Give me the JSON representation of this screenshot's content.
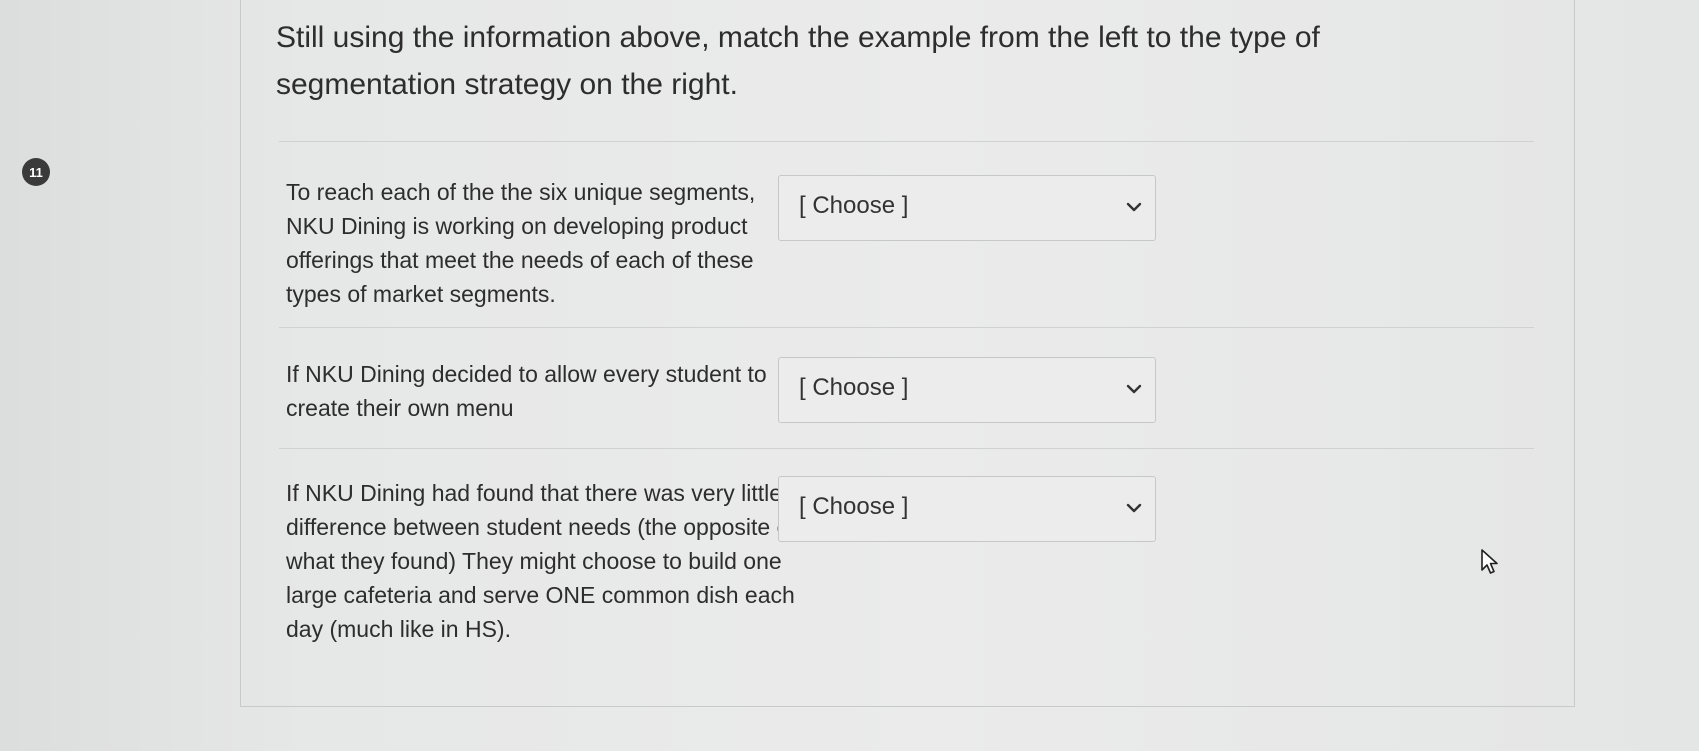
{
  "question": {
    "number": "11",
    "prompt": "Still using the information above, match the example from the left to the type of segmentation strategy on the right."
  },
  "matches": [
    {
      "example": "To reach each of the the six unique segments, NKU Dining is working on developing product offerings that meet the needs of each of these types of market segments.",
      "selected": "[ Choose ]"
    },
    {
      "example": "If NKU Dining decided to allow every student to create their own menu",
      "selected": "[ Choose ]"
    },
    {
      "example": "If NKU Dining had found that there was very little difference between student needs (the opposite of what they found) They might choose to build one large cafeteria and serve ONE common dish each day (much like in HS).",
      "selected": "[ Choose ]"
    }
  ],
  "icons": {
    "dropdown": "chevron-down-icon",
    "pointer": "mouse-cursor-icon"
  }
}
